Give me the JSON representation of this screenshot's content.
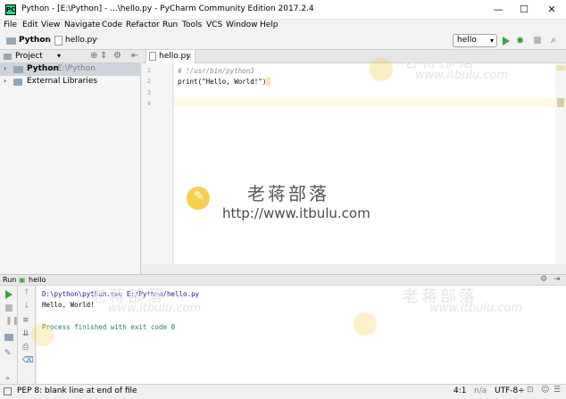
{
  "window": {
    "title": "Python - [E:\\Python] - ...\\hello.py - PyCharm Community Edition 2017.2.4",
    "app_icon_label": "PC",
    "minimize": "—",
    "maximize": "☐",
    "close": "✕"
  },
  "menu": [
    "File",
    "Edit",
    "View",
    "Navigate",
    "Code",
    "Refactor",
    "Run",
    "Tools",
    "VCS",
    "Window",
    "Help"
  ],
  "breadcrumb": {
    "project": "Python",
    "file": "hello.py"
  },
  "run_config": {
    "name": "hello"
  },
  "sidebar": {
    "header": "Project",
    "tree": [
      {
        "label": "Python",
        "path": "E:\\Python"
      },
      {
        "label": "External Libraries"
      }
    ]
  },
  "editor": {
    "tab": "hello.py",
    "line_numbers": [
      "1",
      "2",
      "3",
      "4"
    ],
    "lines": [
      "# !/usr/bin/python3",
      "print(\"Hello, World!\")",
      "",
      ""
    ]
  },
  "watermark": {
    "site_name": "老蒋部落",
    "url": "http://www.itbulu.com",
    "faint_url": "www.itbulu.com"
  },
  "run_panel": {
    "label": "Run",
    "config": "hello",
    "console": [
      "D:\\python\\python.exe E:/Python/hello.py",
      "Hello, World!",
      "",
      "Process finished with exit code 0"
    ]
  },
  "status_bar": {
    "message": "PEP 8: blank line at end of file",
    "position": "4:1",
    "line_sep": "n/a",
    "encoding": "UTF-8÷"
  },
  "colors": {
    "play": "#3ea43a",
    "console_output": "#000000",
    "console_cmd": "#1a1a8c",
    "process_line": "#1a7a7a",
    "code_comment": "#8c8c8c",
    "code_string": "#067d17",
    "watermark_yellow": "#f7cf52"
  }
}
